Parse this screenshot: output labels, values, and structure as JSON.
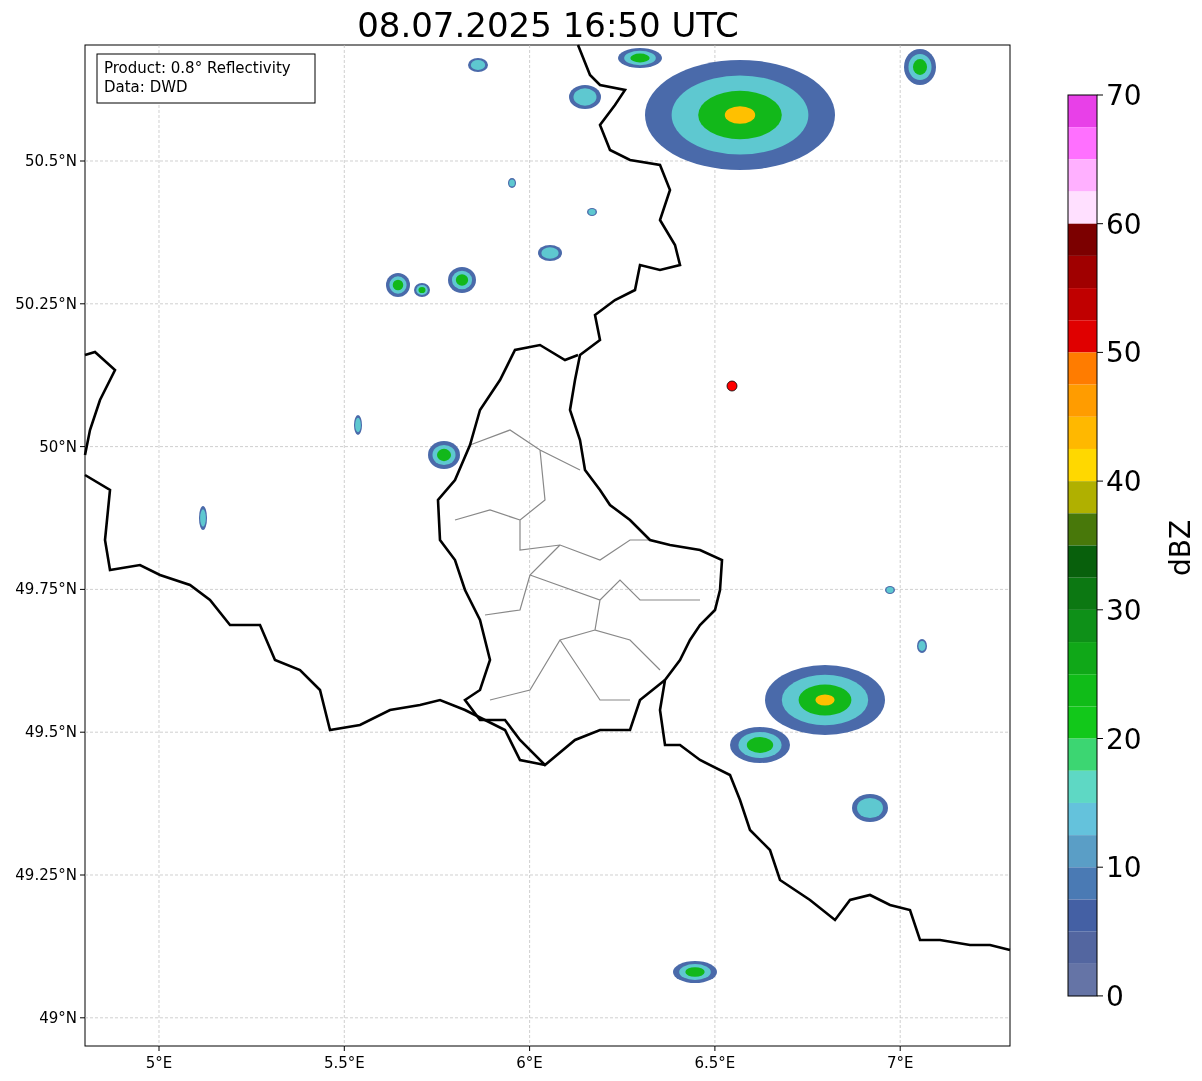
{
  "title": "08.07.2025 16:50 UTC",
  "info_box": [
    "Product: 0.8° Reflectivity",
    "Data: DWD"
  ],
  "lat_ticks": [
    "50.5°N",
    "50.25°N",
    "50°N",
    "49.75°N",
    "49.5°N",
    "49.25°N",
    "49°N"
  ],
  "lon_ticks": [
    "5°E",
    "5.5°E",
    "6°E",
    "6.5°E",
    "7°E"
  ],
  "colorbar": {
    "label": "dBZ",
    "ticks": [
      "70",
      "60",
      "50",
      "40",
      "30",
      "20",
      "10",
      "0"
    ],
    "segments": [
      {
        "color": "#e840e8"
      },
      {
        "color": "#ff70ff"
      },
      {
        "color": "#ffb0ff"
      },
      {
        "color": "#ffe0ff"
      },
      {
        "color": "#7c0000"
      },
      {
        "color": "#a00000"
      },
      {
        "color": "#c00000"
      },
      {
        "color": "#e00000"
      },
      {
        "color": "#ff7c00"
      },
      {
        "color": "#ff9c00"
      },
      {
        "color": "#ffb800"
      },
      {
        "color": "#ffd800"
      },
      {
        "color": "#b0b000"
      },
      {
        "color": "#48780a"
      },
      {
        "color": "#08600c"
      },
      {
        "color": "#0c7812"
      },
      {
        "color": "#0e9018"
      },
      {
        "color": "#10a818"
      },
      {
        "color": "#10bc18"
      },
      {
        "color": "#12c81a"
      },
      {
        "color": "#3cd672"
      },
      {
        "color": "#5ed8c4"
      },
      {
        "color": "#64c2dc"
      },
      {
        "color": "#5a9ec6"
      },
      {
        "color": "#4a7ab4"
      },
      {
        "color": "#4460a4"
      },
      {
        "color": "#5366a0"
      },
      {
        "color": "#6574a6"
      }
    ]
  }
}
